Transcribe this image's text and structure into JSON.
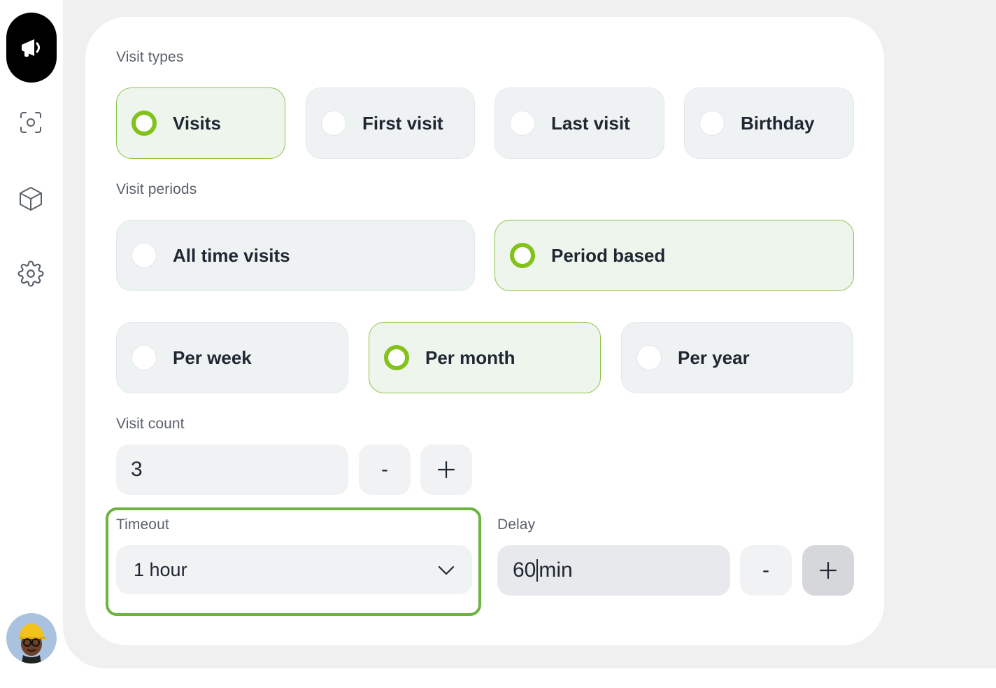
{
  "icons": {
    "logo": "megaphone-icon",
    "nav": [
      "scan-icon",
      "cube-icon",
      "gear-icon"
    ],
    "avatar": "user-avatar"
  },
  "colors": {
    "accent": "#82c21a",
    "selected_border": "#8bc34a",
    "option_bg": "#eff2f3",
    "highlight_border": "#6cb33f"
  },
  "visit_types": {
    "label": "Visit types",
    "options": [
      {
        "label": "Visits",
        "selected": true
      },
      {
        "label": "First visit",
        "selected": false
      },
      {
        "label": "Last visit",
        "selected": false
      },
      {
        "label": "Birthday",
        "selected": false
      }
    ]
  },
  "visit_periods": {
    "label": "Visit periods",
    "options": [
      {
        "label": "All time visits",
        "selected": false
      },
      {
        "label": "Period based",
        "selected": true
      }
    ],
    "sub_options": [
      {
        "label": "Per week",
        "selected": false
      },
      {
        "label": "Per month",
        "selected": true
      },
      {
        "label": "Per year",
        "selected": false
      }
    ]
  },
  "visit_count": {
    "label": "Visit count",
    "value": "3",
    "minus": "-",
    "plus": "+"
  },
  "timeout": {
    "label": "Timeout",
    "value": "1 hour"
  },
  "delay": {
    "label": "Delay",
    "value": "60",
    "unit": "min",
    "minus": "-",
    "plus": "+"
  }
}
